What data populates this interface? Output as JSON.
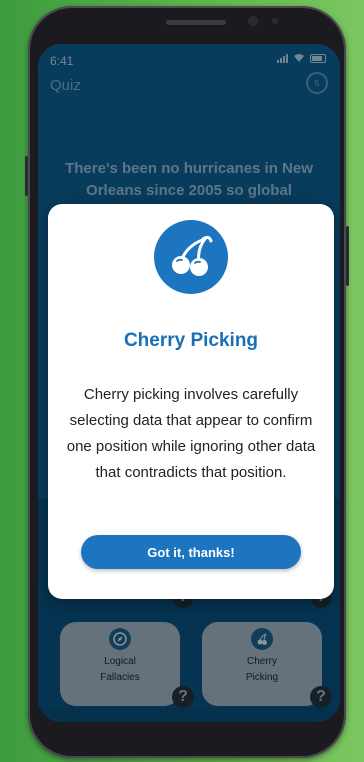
{
  "status_bar": {
    "time": "6:41"
  },
  "header": {
    "title": "Quiz",
    "timer_value": "5"
  },
  "question": {
    "text": "There's been no hurricanes in New Orleans since 2005 so global warming"
  },
  "options": [
    {
      "label": "Logical Fallacies",
      "icon": "compass-icon"
    },
    {
      "label": "Cherry Picking",
      "icon": "cherry-icon"
    }
  ],
  "help_glyph": "?",
  "modal": {
    "icon": "cherry-icon",
    "title": "Cherry Picking",
    "body": "Cherry picking involves carefully selecting data that appear to confirm one position while ignoring other data that contradicts that position.",
    "button_label": "Got it, thanks!"
  },
  "colors": {
    "background_green": "#5fb64b",
    "app_blue": "#0f5e8c",
    "accent_blue": "#1d75c0",
    "tile_gray": "#b8bfc4"
  }
}
